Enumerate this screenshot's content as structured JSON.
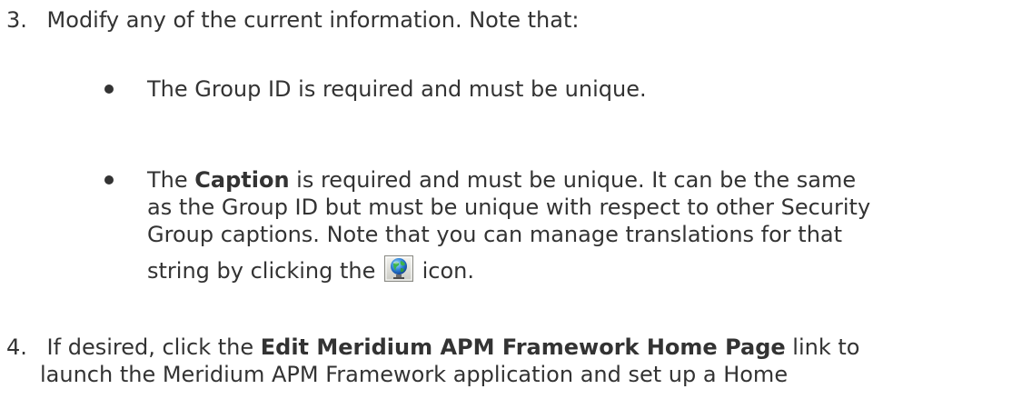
{
  "step3": {
    "number": "3.",
    "text": "Modify any of the current information. Note that:"
  },
  "bullets": [
    {
      "text": "The Group ID is required and must be unique."
    },
    {
      "lead": "The ",
      "bold": "Caption",
      "line1_rest": " is required and must be unique. It can be the same",
      "line2": "as the Group ID but must be unique with respect to other Security",
      "line3": "Group captions. Note that you can manage translations for that",
      "line4_before": "string by clicking the",
      "line4_after": "icon."
    }
  ],
  "step4": {
    "number": "4.",
    "pre": "If desired, click the ",
    "bold": "Edit Meridium APM Framework Home Page",
    "post": " link to",
    "line2": "launch the Meridium APM Framework application and set up a Home"
  },
  "icons": {
    "translation": "globe-icon"
  }
}
